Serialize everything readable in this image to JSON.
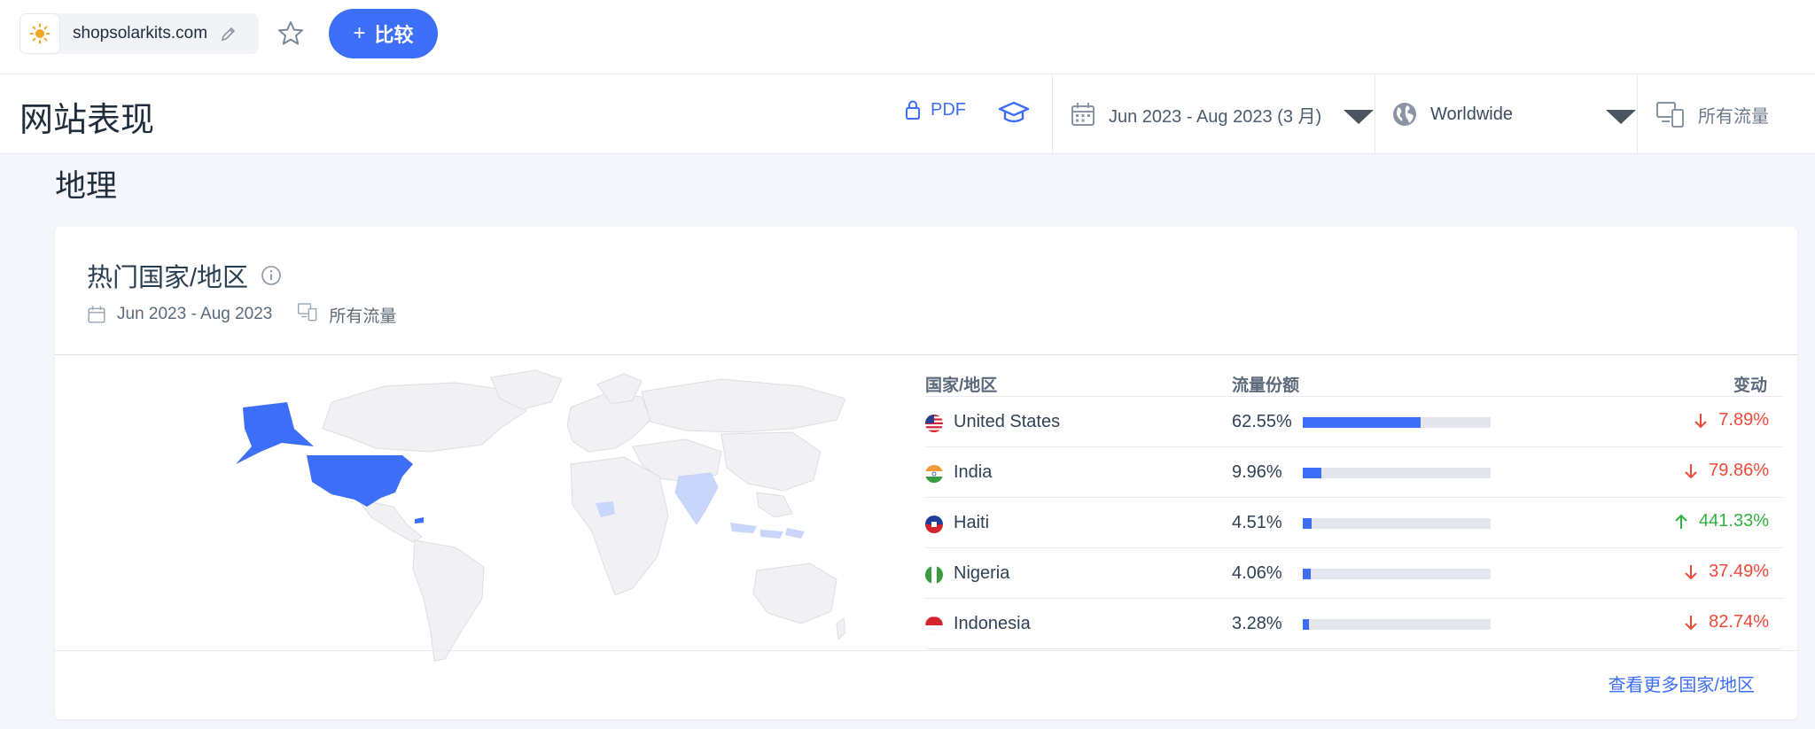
{
  "topbar": {
    "site_name": "shopsolarkits.com",
    "compare_label": "比较",
    "compare_plus": "+"
  },
  "header": {
    "title": "网站表现",
    "pdf_label": "PDF",
    "date_range": "Jun 2023 - Aug 2023 (3 月)",
    "country": "Worldwide",
    "traffic": "所有流量"
  },
  "section": {
    "title": "地理"
  },
  "card": {
    "title": "热门国家/地区",
    "date": "Jun 2023 - Aug 2023",
    "traffic": "所有流量",
    "columns": {
      "country": "国家/地区",
      "share": "流量份额",
      "change": "变动"
    },
    "rows": [
      {
        "country": "United States",
        "share": "62.55%",
        "share_value": 62.55,
        "change": "7.89%",
        "direction": "down"
      },
      {
        "country": "India",
        "share": "9.96%",
        "share_value": 9.96,
        "change": "79.86%",
        "direction": "down"
      },
      {
        "country": "Haiti",
        "share": "4.51%",
        "share_value": 4.51,
        "change": "441.33%",
        "direction": "up"
      },
      {
        "country": "Nigeria",
        "share": "4.06%",
        "share_value": 4.06,
        "change": "37.49%",
        "direction": "down"
      },
      {
        "country": "Indonesia",
        "share": "3.28%",
        "share_value": 3.28,
        "change": "82.74%",
        "direction": "down"
      }
    ],
    "more_link": "查看更多国家/地区"
  },
  "colors": {
    "accent": "#3d6ef8",
    "down": "#f0493a",
    "up": "#33b140",
    "map_highlight": "#3d6ef8",
    "map_light": "#c9d6fb",
    "map_land": "#f1f1f3"
  },
  "icons": {
    "site": "sun-icon",
    "edit": "pencil-icon",
    "favorite": "star-icon",
    "pdf": "lock-icon",
    "academy": "graduation-cap-icon",
    "date": "calendar-icon",
    "country": "globe-icon",
    "traffic": "devices-icon",
    "info": "info-icon",
    "down": "arrow-down-icon",
    "up": "arrow-up-icon"
  }
}
